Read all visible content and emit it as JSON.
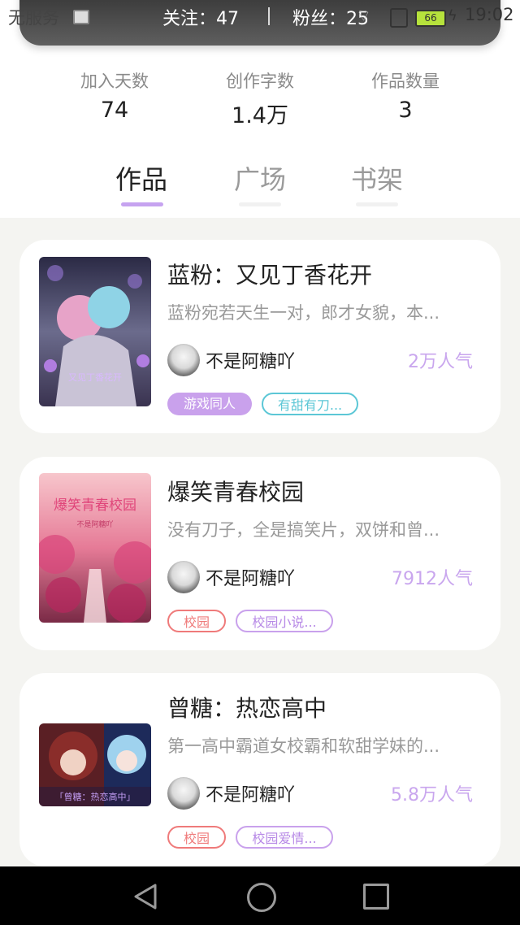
{
  "status_bar": {
    "left_text": "无服务",
    "time": "19:02",
    "battery": "66"
  },
  "header": {
    "follow": "关注：47",
    "fans": "粉丝：25"
  },
  "stats": [
    {
      "label": "加入天数",
      "value": "74"
    },
    {
      "label": "创作字数",
      "value": "1.4万"
    },
    {
      "label": "作品数量",
      "value": "3"
    }
  ],
  "tabs": [
    {
      "label": "作品",
      "active": true
    },
    {
      "label": "广场",
      "active": false
    },
    {
      "label": "书架",
      "active": false
    }
  ],
  "works": [
    {
      "title": "蓝粉：又见丁香花开",
      "desc": "蓝粉宛若天生一对，郎才女貌，本...",
      "author": "不是阿糖吖",
      "popularity": "2万人气",
      "tags": [
        "游戏同人",
        "有甜有刀..."
      ],
      "cover_text": "又见丁香花开"
    },
    {
      "title": "爆笑青春校园",
      "desc": "没有刀子，全是搞笑片，双饼和曾...",
      "author": "不是阿糖吖",
      "popularity": "7912人气",
      "tags": [
        "校园",
        "校园小说..."
      ],
      "cover_text": "爆笑青春校园",
      "cover_sub": "不是阿糖吖"
    },
    {
      "title": "曾糖：热恋高中",
      "desc": "第一高中霸道女校霸和软甜学妹的...",
      "author": "不是阿糖吖",
      "popularity": "5.8万人气",
      "tags": [
        "校园",
        "校园爱情..."
      ],
      "cover_text": "「曾糖：热恋高中」"
    }
  ],
  "colors": {
    "accent": "#c6a3f0",
    "popularity": "#c9a6ee",
    "tag_purple_bg": "#c9a1ec",
    "tag_teal": "#5cc7d6",
    "tag_red": "#ef7a7a"
  }
}
